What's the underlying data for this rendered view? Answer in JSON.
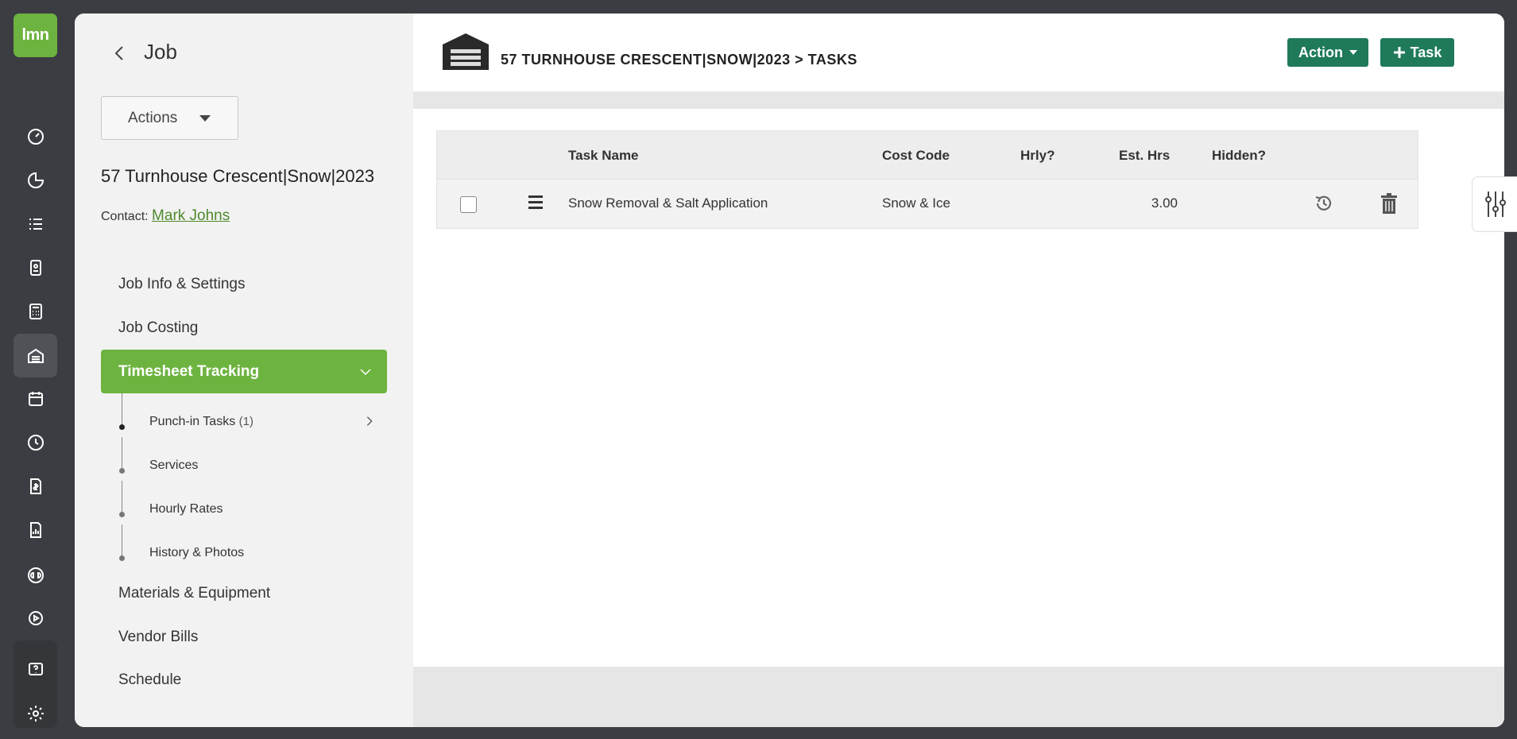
{
  "app": {
    "logo_text": "lmn"
  },
  "rail": {
    "icons": [
      "dashboard-icon",
      "chart-icon",
      "list-icon",
      "contact-card-icon",
      "calculator-icon",
      "garage-icon",
      "calendar-icon",
      "clock-icon",
      "invoice-icon",
      "report-icon",
      "quickbooks-icon",
      "play-icon",
      "help-icon",
      "gear-icon"
    ],
    "active": "garage-icon"
  },
  "sidebar": {
    "title": "Job",
    "actions_label": "Actions",
    "job_name": "57 Turnhouse Crescent|Snow|2023",
    "contact_label": "Contact:",
    "contact_name": "Mark Johns",
    "nav": [
      {
        "label": "Job Info & Settings"
      },
      {
        "label": "Job Costing"
      },
      {
        "label": "Timesheet Tracking"
      },
      {
        "label": "Materials & Equipment"
      },
      {
        "label": "Vendor Bills"
      },
      {
        "label": "Schedule"
      }
    ],
    "sub": [
      {
        "label": "Punch-in Tasks",
        "count": "(1)"
      },
      {
        "label": "Services"
      },
      {
        "label": "Hourly Rates"
      },
      {
        "label": "History & Photos"
      }
    ]
  },
  "header": {
    "title": "57 TURNHOUSE CRESCENT|SNOW|2023 > TASKS",
    "action_label": "Action",
    "task_label": "Task"
  },
  "table": {
    "columns": [
      "Task Name",
      "Cost Code",
      "Hrly?",
      "Est. Hrs",
      "Hidden?"
    ],
    "rows": [
      {
        "task_name": "Snow Removal & Salt Application",
        "cost_code": "Snow & Ice",
        "hourly": "",
        "est_hrs": "3.00",
        "hidden": ""
      }
    ]
  },
  "colors": {
    "accent_green": "#6db33f",
    "button_teal": "#1f7a5a",
    "rail_bg": "#3b3d42"
  }
}
